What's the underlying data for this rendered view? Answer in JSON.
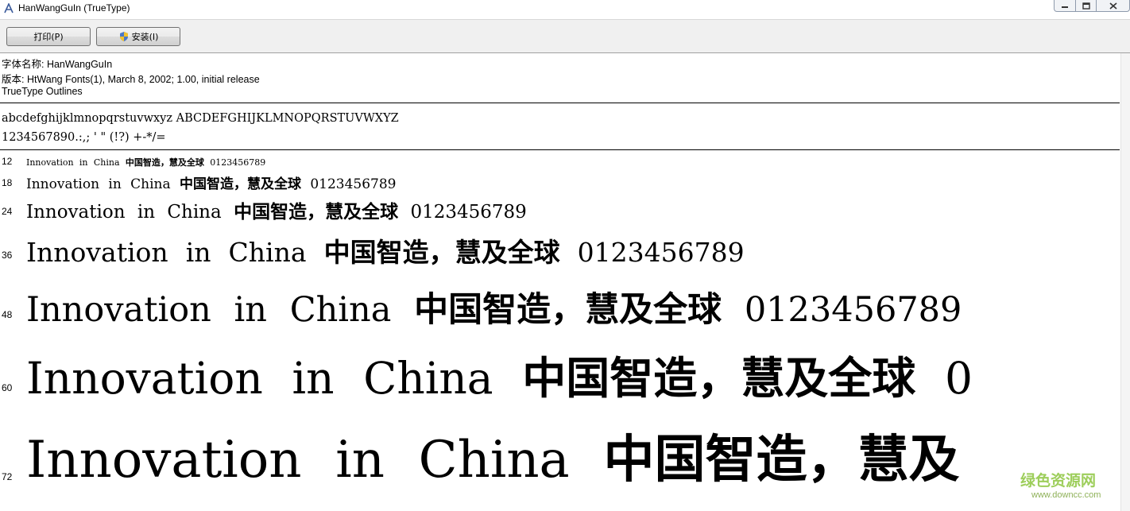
{
  "window": {
    "title": "HanWangGuIn (TrueType)"
  },
  "toolbar": {
    "print_label": "打印(P)",
    "install_label": "安装(I)"
  },
  "info": {
    "font_name": "字体名称: HanWangGuIn",
    "version": "版本: HtWang Fonts(1), March 8, 2002; 1.00, initial release",
    "outline_type": "TrueType Outlines"
  },
  "charset": {
    "letters": "abcdefghijklmnopqrstuvwxyz  ABCDEFGHIJKLMNOPQRSTUVWXYZ",
    "digits_symbols": "1234567890.:,;  '  \"  (!?)   +-*/="
  },
  "samples": [
    {
      "size": "12",
      "latin": "Innovation in China",
      "cjk": "中国智造，慧及全球",
      "digits": "0123456789"
    },
    {
      "size": "18",
      "latin": "Innovation in China",
      "cjk": "中国智造，慧及全球",
      "digits": "0123456789"
    },
    {
      "size": "24",
      "latin": "Innovation in China",
      "cjk": "中国智造，慧及全球",
      "digits": "0123456789"
    },
    {
      "size": "36",
      "latin": "Innovation in China",
      "cjk": "中国智造，慧及全球",
      "digits": "0123456789"
    },
    {
      "size": "48",
      "latin": "Innovation in China",
      "cjk": "中国智造，慧及全球",
      "digits": "0123456789"
    },
    {
      "size": "60",
      "latin": "Innovation in China",
      "cjk": "中国智造，慧及全球",
      "digits": "0"
    },
    {
      "size": "72",
      "latin": "Innovation in China",
      "cjk": "中国智造，慧及",
      "digits": ""
    }
  ],
  "watermark": {
    "text": "绿色资源网",
    "url": "www.downcc.com"
  },
  "colors": {
    "toolbar_bg": "#f0f0f0",
    "watermark": "#8dc63f"
  },
  "icons": {
    "app": "font-app-icon",
    "install": "uac-shield-icon",
    "minimize": "minimize-icon",
    "maximize": "maximize-icon",
    "close": "close-icon"
  }
}
